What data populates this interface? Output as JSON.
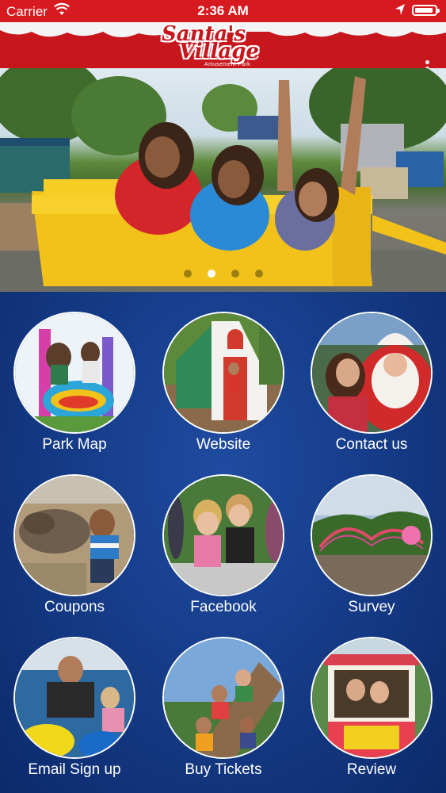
{
  "status_bar": {
    "carrier": "Carrier",
    "time": "2:36 AM",
    "battery_level": 0.9
  },
  "header": {
    "logo_line1": "Santa's",
    "logo_line2": "Village",
    "logo_sub": "Amusement Park"
  },
  "hero": {
    "slide_count": 4,
    "active_slide": 2
  },
  "menu": [
    {
      "label": "Park Map"
    },
    {
      "label": "Website"
    },
    {
      "label": "Contact us"
    },
    {
      "label": "Coupons"
    },
    {
      "label": "Facebook"
    },
    {
      "label": "Survey"
    },
    {
      "label": "Email Sign up"
    },
    {
      "label": "Buy Tickets"
    },
    {
      "label": "Review"
    }
  ],
  "colors": {
    "brand_red": "#c8161d",
    "background_blue": "#163d8a"
  }
}
